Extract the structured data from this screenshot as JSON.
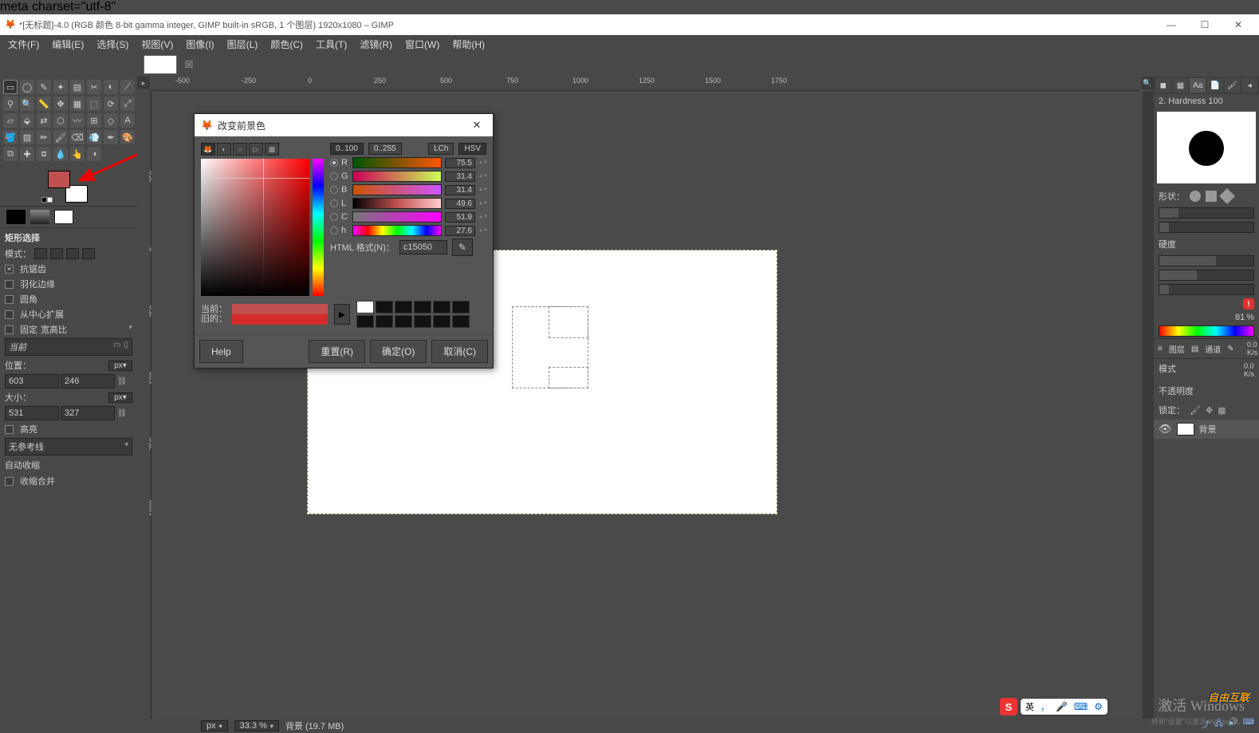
{
  "titlebar": {
    "text": "*[无标题]-4.0 (RGB 颜色 8-bit gamma integer, GIMP built-in sRGB, 1 个图层) 1920x1080 – GIMP"
  },
  "menubar": [
    "文件(F)",
    "编辑(E)",
    "选择(S)",
    "视图(V)",
    "图像(I)",
    "图层(L)",
    "颜色(C)",
    "工具(T)",
    "滤镜(R)",
    "窗口(W)",
    "帮助(H)"
  ],
  "tool_options": {
    "title": "矩形选择",
    "mode_label": "模式：",
    "antialias": "抗锯齿",
    "feather": "羽化边缘",
    "rounded": "圆角",
    "expand_center": "从中心扩展",
    "fixed_label": "固定",
    "fixed_value": "宽高比",
    "current_label": "当前",
    "position_label": "位置：",
    "pos_x": "603",
    "pos_y": "246",
    "size_label": "大小：",
    "size_w": "531",
    "size_h": "327",
    "unit": "px",
    "highlight": "高亮",
    "guides_label": "无参考线",
    "auto_shrink": "自动收缩",
    "shrink_merged": "收缩合并"
  },
  "ruler_h": [
    "0",
    "250",
    "500",
    "750",
    "1000",
    "1250",
    "1500",
    "1750"
  ],
  "ruler_h_neg": [
    "-500",
    "-250"
  ],
  "ruler_v": [
    "0",
    "250",
    "500",
    "750",
    "1000"
  ],
  "ruler_v_neg": [
    "-250"
  ],
  "dialog": {
    "title": "改变前景色",
    "range_100": "0..100",
    "range_255": "0..255",
    "model_lch": "LCh",
    "model_hsv": "HSV",
    "channels": {
      "R": "75.5",
      "G": "31.4",
      "B": "31.4",
      "L": "49.6",
      "C": "51.9",
      "h": "27.6"
    },
    "html_label": "HTML 格式(N)：",
    "html_value": "c15050",
    "current_label": "当前：",
    "old_label": "旧的：",
    "help": "Help",
    "reset": "重置(R)",
    "ok": "确定(O)",
    "cancel": "取消(C)"
  },
  "right_panel": {
    "brush_title": "2. Hardness 100",
    "shape_label": "形状：",
    "hardness_label": "硬度",
    "percent": "81",
    "pct_suffix": "%",
    "kps1": "0.0",
    "kps2": "0.0",
    "kps_unit": "K/s",
    "layers_tab": "图层",
    "channels_tab": "通道",
    "mode_label": "模式",
    "opacity_label": "不透明度",
    "lock_label": "锁定：",
    "bg_layer": "背景"
  },
  "statusbar": {
    "unit": "px",
    "zoom": "33.3 %",
    "layer_info": "背景 (19.7 MB)"
  },
  "watermark": "激活 Windows",
  "watermark_sub": "转到\"设置\"以激活 Windows。",
  "brand_overlay": "自由互联",
  "ime": {
    "lang": "英",
    "comma": "，"
  }
}
